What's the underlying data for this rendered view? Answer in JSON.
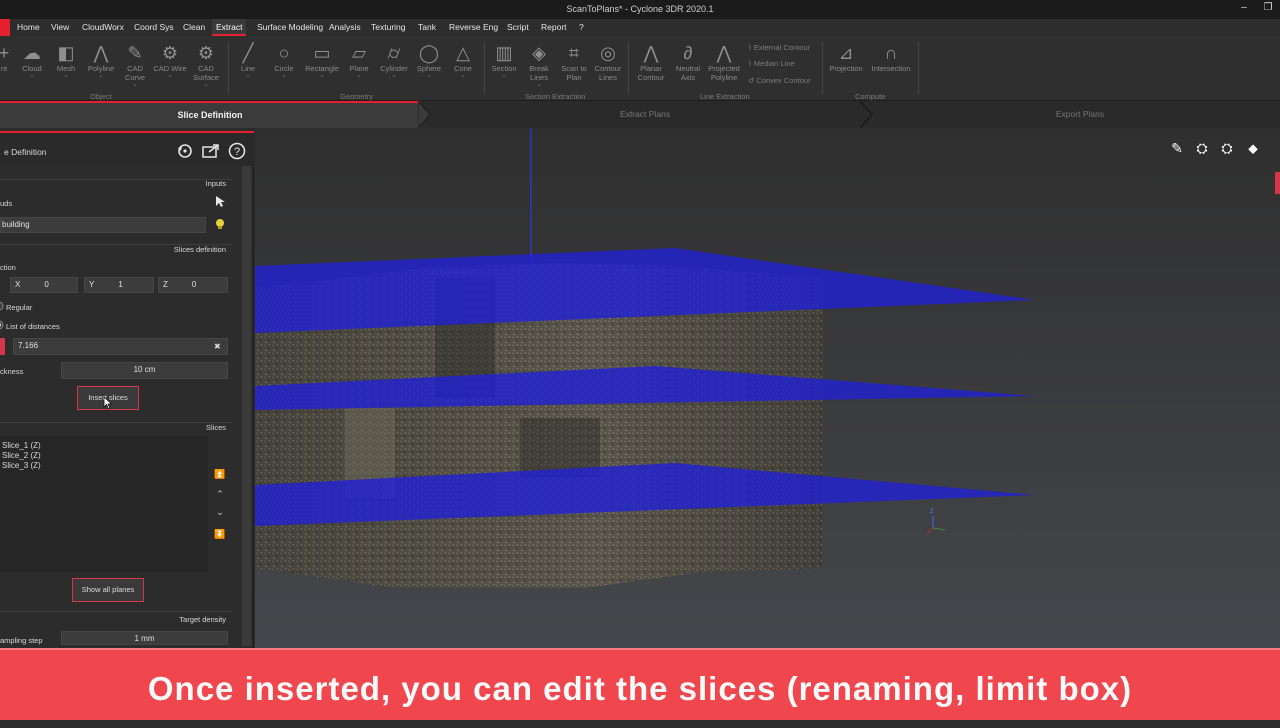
{
  "window": {
    "title": "ScanToPlans* - Cyclone 3DR 2020.1",
    "controls": [
      "–",
      "❐"
    ]
  },
  "menu": [
    "Home",
    "View",
    "CloudWorx",
    "Coord Sys",
    "Clean",
    "Extract",
    "Surface Modeling",
    "Analysis",
    "Texturing",
    "Tank",
    "Reverse Eng",
    "Script",
    "Report",
    "?"
  ],
  "menu_active": "Extract",
  "ribbon": {
    "buttons": [
      {
        "label": "nt",
        "icon": "+"
      },
      {
        "label": "Cloud",
        "icon": "☁",
        "arrow": "⌄"
      },
      {
        "label": "Mesh",
        "icon": "◧",
        "arrow": "⌄"
      },
      {
        "label": "Polyline",
        "icon": "⋀",
        "arrow": "⌄"
      },
      {
        "label": "CAD\nCurve",
        "icon": "✎",
        "arrow": "⌄"
      },
      {
        "label": "CAD Wire",
        "icon": "⚙",
        "arrow": "⌄"
      },
      {
        "label": "CAD\nSurface",
        "icon": "⚙",
        "arrow": "⌄"
      },
      {
        "label": "Line",
        "icon": "╱",
        "arrow": "⌄"
      },
      {
        "label": "Circle",
        "icon": "○",
        "arrow": "⌄"
      },
      {
        "label": "Rectangle",
        "icon": "▭",
        "arrow": "⌄"
      },
      {
        "label": "Plane",
        "icon": "▱",
        "arrow": "⌄"
      },
      {
        "label": "Cylinder",
        "icon": "⌭",
        "arrow": "⌄"
      },
      {
        "label": "Sphere",
        "icon": "◯",
        "arrow": "⌄"
      },
      {
        "label": "Cone",
        "icon": "△",
        "arrow": "⌄"
      },
      {
        "label": "Section",
        "icon": "▥",
        "arrow": "⌄"
      },
      {
        "label": "Break\nLines",
        "icon": "◈",
        "arrow": "⌄"
      },
      {
        "label": "Scan to\nPlan",
        "icon": "⌗"
      },
      {
        "label": "Contour\nLines",
        "icon": "◎"
      },
      {
        "label": "Planar\nContour",
        "icon": "⋀"
      },
      {
        "label": "Neutral\nAxis",
        "icon": "∂"
      },
      {
        "label": "Projected\nPolyline",
        "icon": "⋀"
      },
      {
        "label": "Projection",
        "icon": "⊿"
      },
      {
        "label": "Intersection",
        "icon": "∩"
      }
    ],
    "mini": [
      "External Contour",
      "Median Line",
      "Convex Contour"
    ],
    "groups": [
      "Object",
      "Geometry",
      "Section Extraction",
      "Line Extraction",
      "Compute"
    ]
  },
  "steps": [
    "Slice Definition",
    "Extract Plans",
    "Export Plans"
  ],
  "panel": {
    "title": "e Definition",
    "icons": [
      "reset-icon",
      "export-icon",
      "help-icon"
    ],
    "sections": {
      "inputs": "Inputs",
      "slices_def": "Slices definition",
      "slices": "Slices",
      "target": "Target density"
    },
    "clouds_label": "uds",
    "cloud_value": "building",
    "direction_label": "ction",
    "dir": {
      "x_label": "X",
      "x": "0",
      "y_label": "Y",
      "y": "1",
      "z_label": "Z",
      "z": "0"
    },
    "regular": "Regular",
    "list_distances": "List of distances",
    "distance_value": "7.166",
    "clear": "✖",
    "thickness_label": "ckness",
    "thickness_value": "10 cm",
    "insert_button": "Insert slices",
    "slices": [
      "Slice_1 (Z)",
      "Slice_2 (Z)",
      "Slice_3 (Z)"
    ],
    "arrows": [
      "⏫",
      "⌃",
      "⌄",
      "⏬"
    ],
    "show_all_button": "Show all planes",
    "sampling_label": "ampling step",
    "sampling_value": "1 mm"
  },
  "viewport": {
    "tools": [
      "measure-icon",
      "pick-icon",
      "unpick-icon",
      "tag-icon"
    ],
    "tool_glyphs": [
      "✎",
      "⛭",
      "⛭",
      "⬥"
    ],
    "axis_label": "Z"
  },
  "caption": "Once inserted, you can edit the slices (renaming, limit box)",
  "colors": {
    "accent": "#e5202e",
    "banner": "#f0464e",
    "slice_plane": "#2020d8"
  }
}
